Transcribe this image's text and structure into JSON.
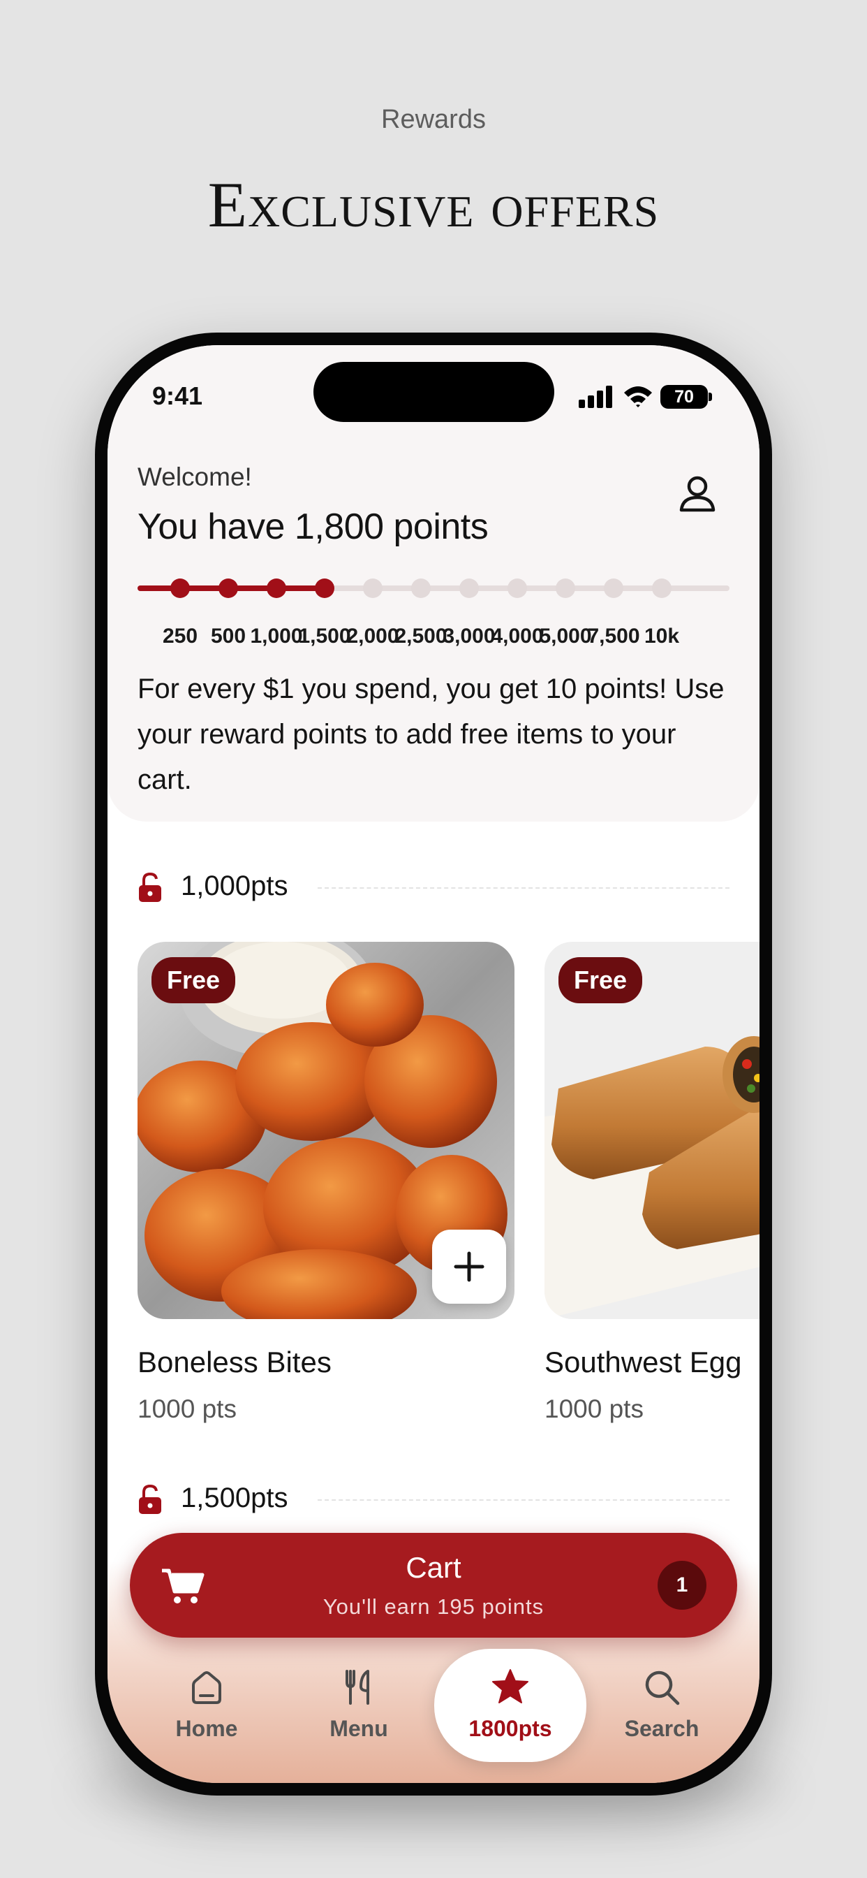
{
  "page": {
    "eyebrow": "Rewards",
    "headline": "Exclusive offers"
  },
  "status_bar": {
    "time": "9:41",
    "battery": "70"
  },
  "header": {
    "welcome": "Welcome!",
    "points_title": "You have 1,800 points",
    "progress": {
      "current_points": 1800,
      "milestones": [
        "250",
        "500",
        "1,000",
        "1,500",
        "2,000",
        "2,500",
        "3,000",
        "4,000",
        "5,000",
        "7,500",
        "10k"
      ],
      "reached_count": 4
    },
    "info_text": "For every $1 you spend, you get 10 points! Use your reward points to add free items to your cart."
  },
  "sections": [
    {
      "label": "1,000pts",
      "items": [
        {
          "badge": "Free",
          "name": "Boneless Bites",
          "pts": "1000 pts"
        },
        {
          "badge": "Free",
          "name": "Southwest Egg",
          "pts": "1000 pts"
        }
      ]
    },
    {
      "label": "1,500pts"
    }
  ],
  "cart": {
    "title": "Cart",
    "subtitle": "You'll earn 195 points",
    "count": "1"
  },
  "tabs": [
    {
      "label": "Home",
      "icon": "home-icon",
      "active": false
    },
    {
      "label": "Menu",
      "icon": "utensils-icon",
      "active": false
    },
    {
      "label": "1800pts",
      "icon": "star-icon",
      "active": true
    },
    {
      "label": "Search",
      "icon": "search-icon",
      "active": false
    }
  ],
  "colors": {
    "brand": "#a61b1f",
    "brand_dark": "#6b0d10",
    "background": "#e4e4e4"
  }
}
